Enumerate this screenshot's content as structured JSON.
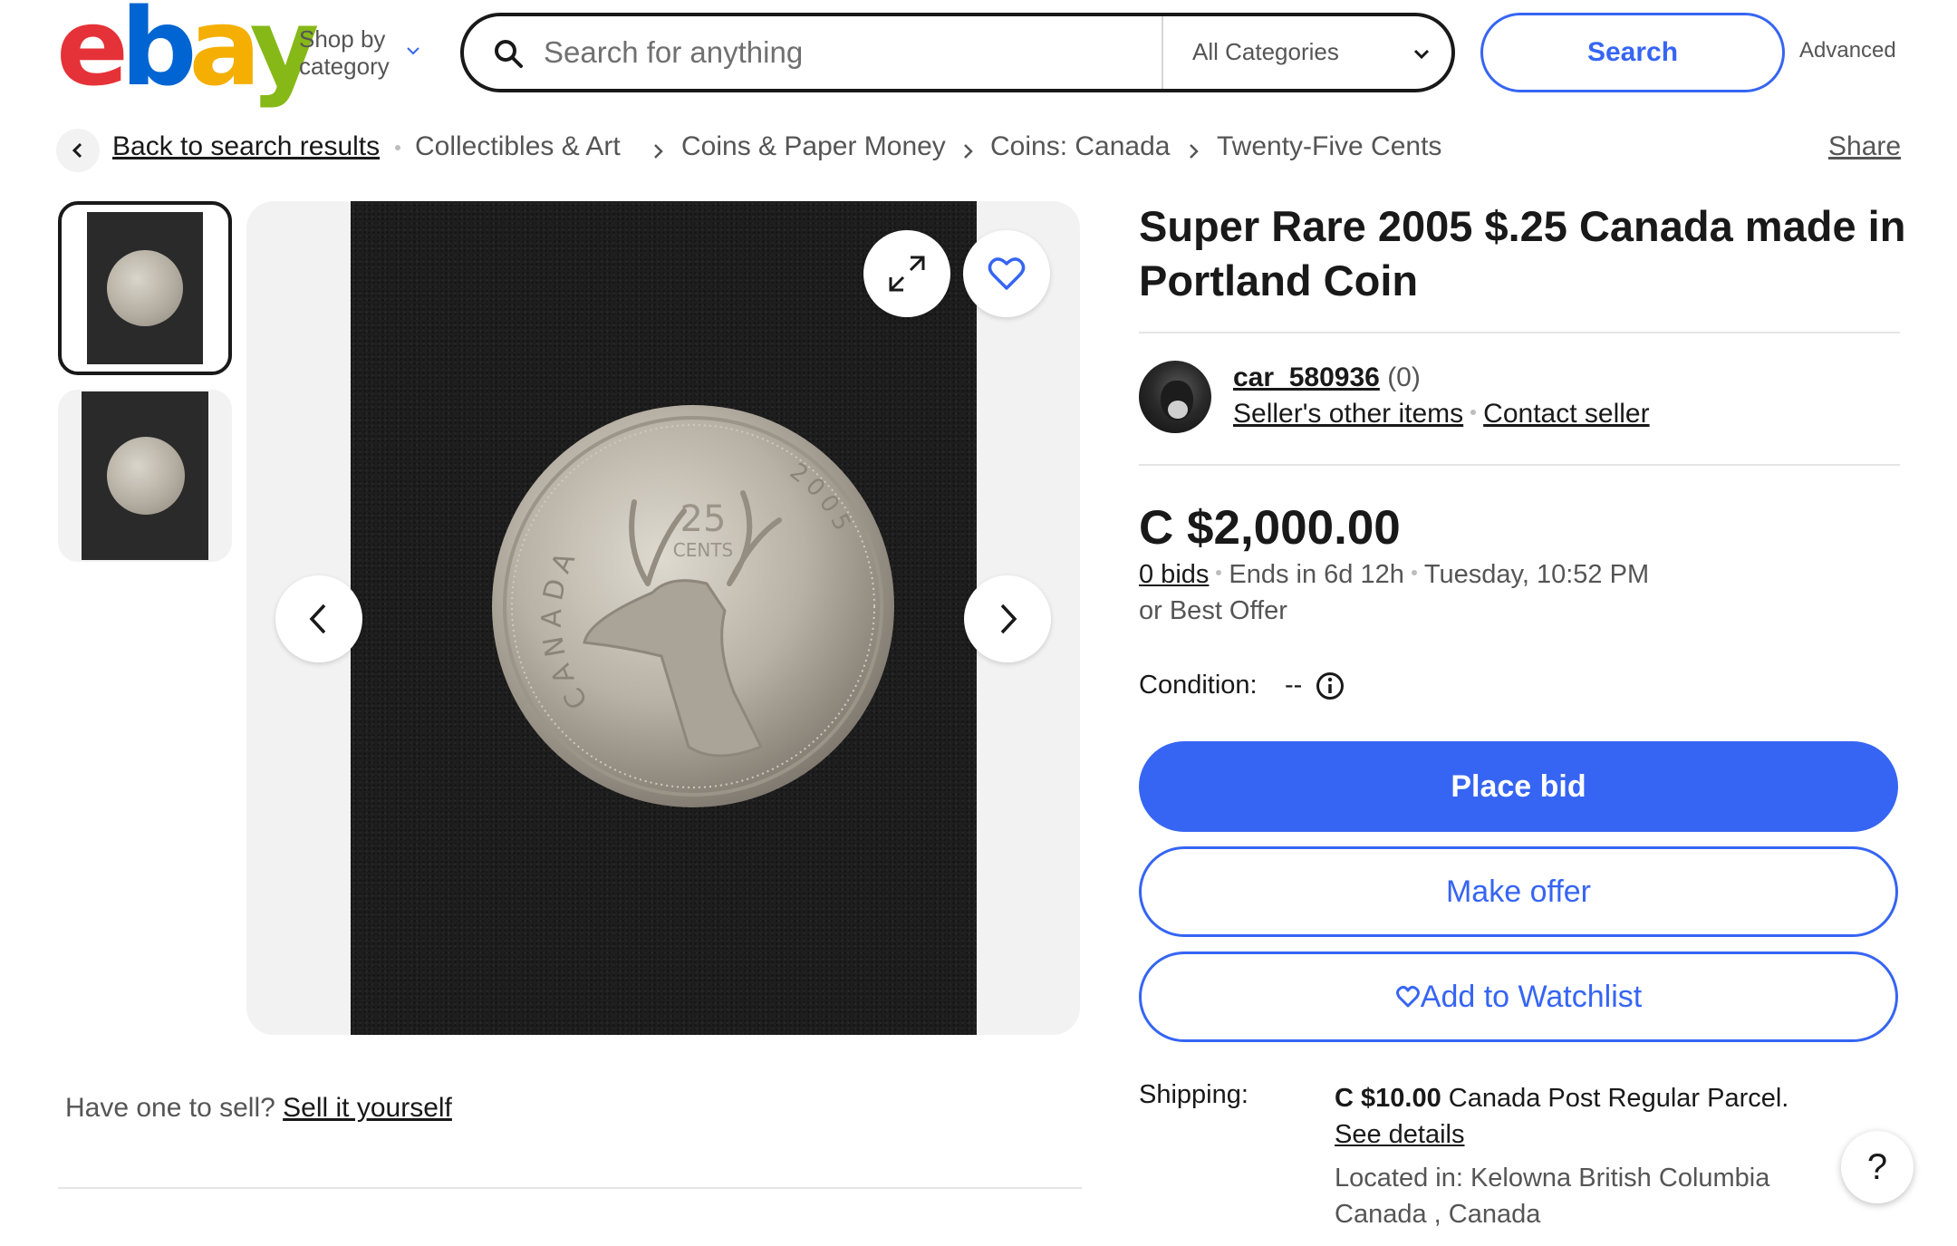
{
  "header": {
    "logo_letters": [
      "e",
      "b",
      "a",
      "y"
    ],
    "shop_by_line1": "Shop by",
    "shop_by_line2": "category",
    "search_placeholder": "Search for anything",
    "category_selected": "All Categories",
    "search_button": "Search",
    "advanced": "Advanced"
  },
  "breadcrumb": {
    "back": "Back to search results",
    "items": [
      "Collectibles & Art",
      "Coins & Paper Money",
      "Coins: Canada",
      "Twenty-Five Cents"
    ],
    "share": "Share"
  },
  "gallery": {
    "thumbnail_count": 2,
    "selected_thumbnail": 1,
    "coin_text_country": "CANADA",
    "coin_text_value": "25",
    "coin_text_cents": "CENTS",
    "coin_text_year": "2005"
  },
  "sell": {
    "prompt": "Have one to sell?",
    "link": "Sell it yourself"
  },
  "listing": {
    "title": "Super Rare 2005 $.25 Canada made in Portland Coin",
    "seller": {
      "username": "car_580936",
      "feedback": "(0)",
      "other_items": "Seller's other items",
      "contact": "Contact seller"
    },
    "price": "C $2,000.00",
    "bids": "0 bids",
    "ends_in": "Ends in 6d 12h",
    "end_time": "Tuesday, 10:52 PM",
    "best_offer": "or Best Offer",
    "condition_label": "Condition:",
    "condition_value": "--",
    "place_bid": "Place bid",
    "make_offer": "Make offer",
    "watchlist": "Add to Watchlist",
    "shipping_label": "Shipping:",
    "shipping_price": "C $10.00",
    "shipping_method": "Canada Post Regular Parcel.",
    "see_details": "See details",
    "located_line1": "Located in: Kelowna British Columbia",
    "located_line2": "Canada , Canada"
  },
  "help": "?",
  "colors": {
    "accent": "#3665f3",
    "text": "#191919",
    "muted": "#555555",
    "logo_red": "#e53238",
    "logo_blue": "#0064d2",
    "logo_yellow": "#f5af02",
    "logo_green": "#86b817"
  },
  "icons": [
    "search-icon",
    "chevron-down-icon",
    "chevron-left-icon",
    "chevron-right-icon",
    "expand-icon",
    "heart-icon",
    "info-icon",
    "help-icon"
  ]
}
